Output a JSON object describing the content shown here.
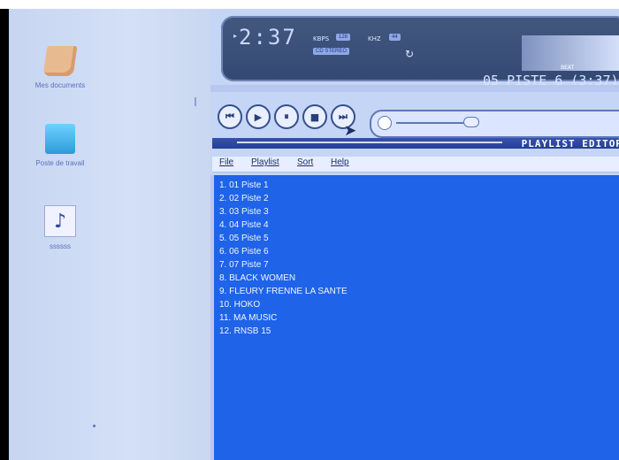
{
  "desktop": {
    "icons": [
      {
        "name": "folder-icon",
        "label": "Mes documents"
      },
      {
        "name": "computer-icon",
        "label": "Poste de travail"
      },
      {
        "name": "music-file-icon",
        "label": "ssssss"
      }
    ]
  },
  "player": {
    "time": "2:37",
    "bitrate_label": "KBPS",
    "bitrate_value": "128",
    "khz_label": "KHZ",
    "khz_value": "44",
    "mode_badge": "CD STEREO",
    "track_display": "05 PISTE 6 (3:37)",
    "eq_label": "BEAT",
    "buttons": [
      "prev",
      "play",
      "pause",
      "stop",
      "next"
    ]
  },
  "playlist": {
    "title": "PLAYLIST EDITOR",
    "menu": [
      "File",
      "Playlist",
      "Sort",
      "Help"
    ],
    "items": [
      "1. 01 Piste 1",
      "2. 02 Piste 2",
      "3. 03 Piste 3",
      "4. 04 Piste 4",
      "5. 05 Piste 5",
      "6. 06 Piste 6",
      "7. 07 Piste 7",
      "8. BLACK WOMEN",
      "9. FLEURY FRENNE LA SANTE",
      "10. HOKO",
      "11. MA MUSIC",
      "12. RNSB 15"
    ]
  }
}
